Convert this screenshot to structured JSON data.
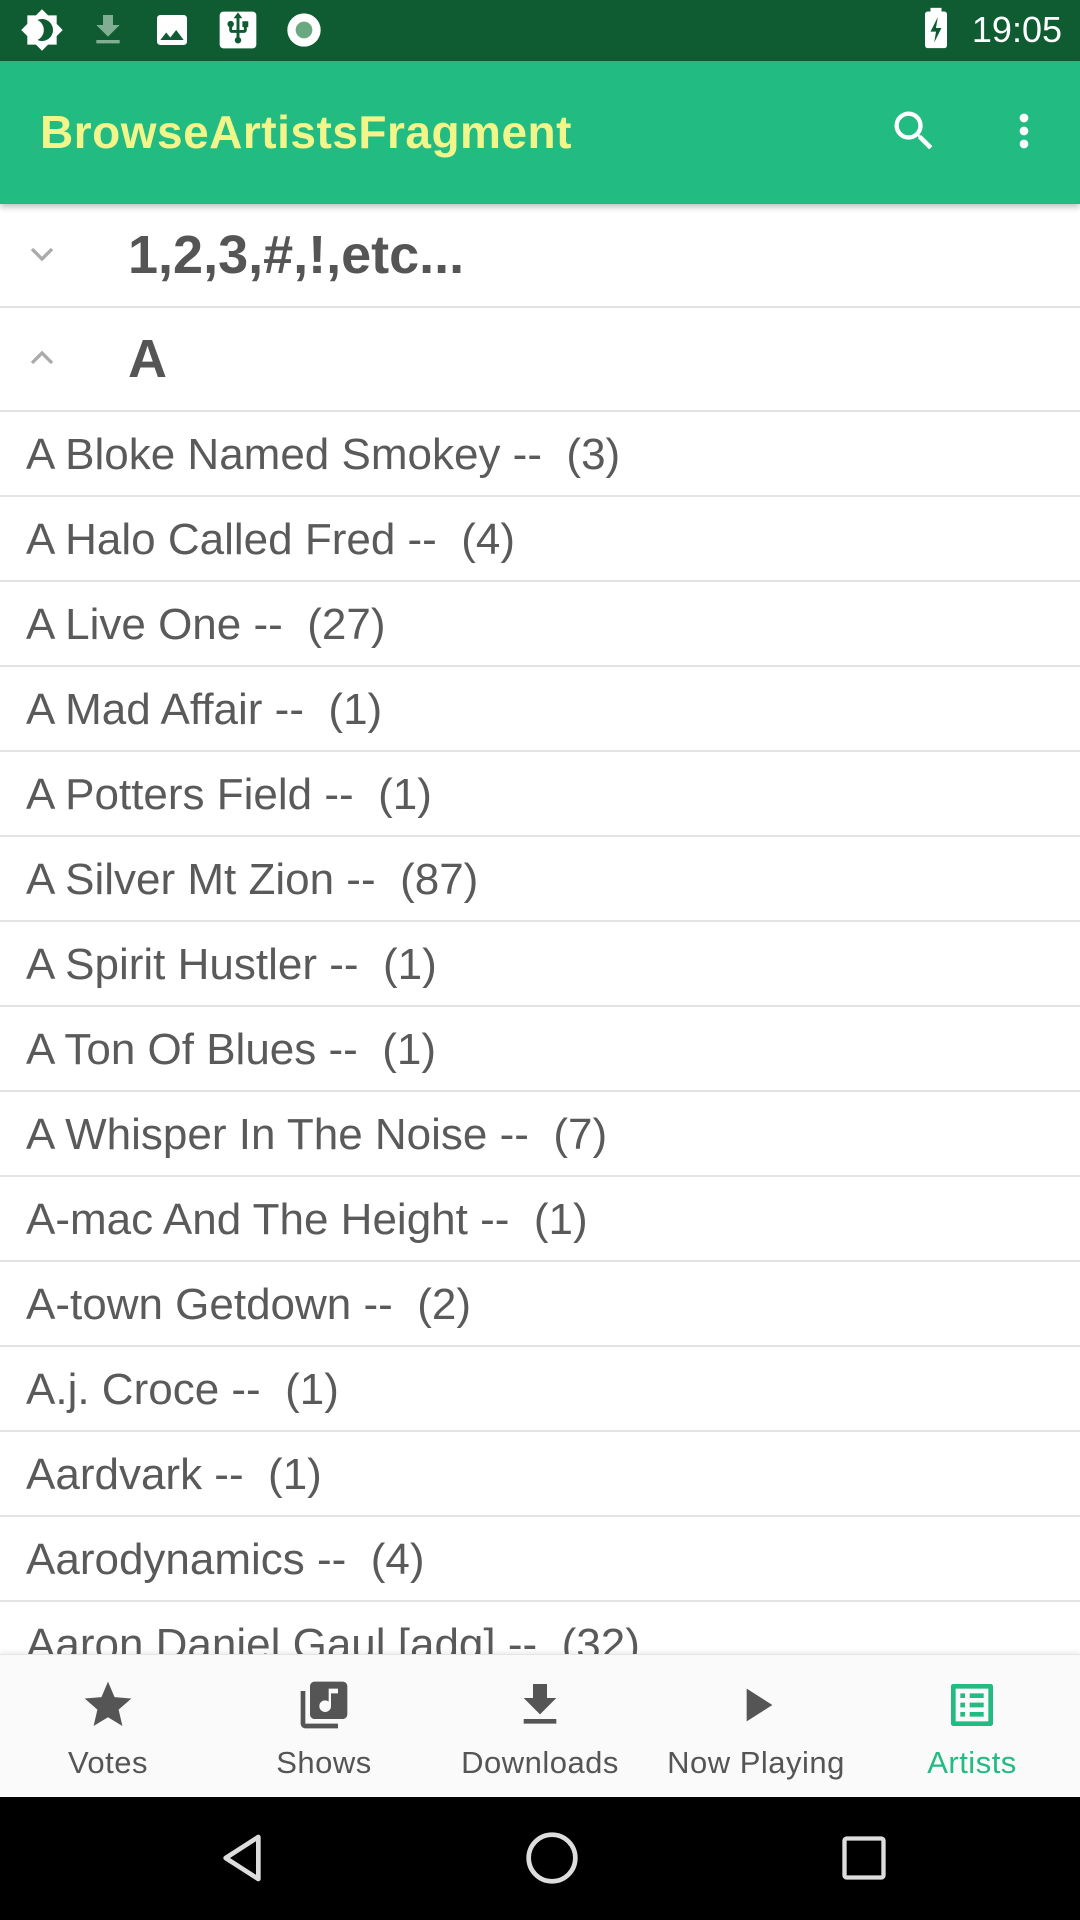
{
  "status_bar": {
    "time": "19:05",
    "icons": [
      "brightness-icon",
      "download-icon",
      "image-icon",
      "usb-icon",
      "record-icon",
      "battery-charging-icon"
    ]
  },
  "app_bar": {
    "title": "BrowseArtistsFragment",
    "actions": [
      "search-icon",
      "more-vert-icon"
    ],
    "background_color": "#22bb82",
    "title_color": "#f1f58a"
  },
  "groups": [
    {
      "label": "1,2,3,#,!,etc...",
      "expanded": false
    },
    {
      "label": "A",
      "expanded": true
    }
  ],
  "artists": [
    {
      "text": "A Bloke Named Smokey --  (3)"
    },
    {
      "text": "A Halo Called Fred --  (4)"
    },
    {
      "text": "A Live One --  (27)"
    },
    {
      "text": "A Mad Affair --  (1)"
    },
    {
      "text": "A Potters Field --  (1)"
    },
    {
      "text": "A Silver Mt Zion --  (87)"
    },
    {
      "text": "A Spirit Hustler --  (1)"
    },
    {
      "text": "A Ton Of Blues --  (1)"
    },
    {
      "text": "A Whisper In The Noise --  (7)"
    },
    {
      "text": "A-mac And The Height --  (1)"
    },
    {
      "text": "A-town Getdown --  (2)"
    },
    {
      "text": "A.j. Croce --  (1)"
    },
    {
      "text": "Aardvark --  (1)"
    },
    {
      "text": "Aarodynamics --  (4)"
    },
    {
      "text": "Aaron Daniel Gaul [adg] --  (32)"
    }
  ],
  "bottom_nav": {
    "active_color": "#22bb82",
    "items": [
      {
        "label": "Votes",
        "icon": "star-icon"
      },
      {
        "label": "Shows",
        "icon": "music-library-icon"
      },
      {
        "label": "Downloads",
        "icon": "download-icon"
      },
      {
        "label": "Now Playing",
        "icon": "play-icon"
      },
      {
        "label": "Artists",
        "icon": "list-icon",
        "active": true
      }
    ]
  },
  "system_nav": [
    "back-icon",
    "home-icon",
    "recents-icon"
  ]
}
